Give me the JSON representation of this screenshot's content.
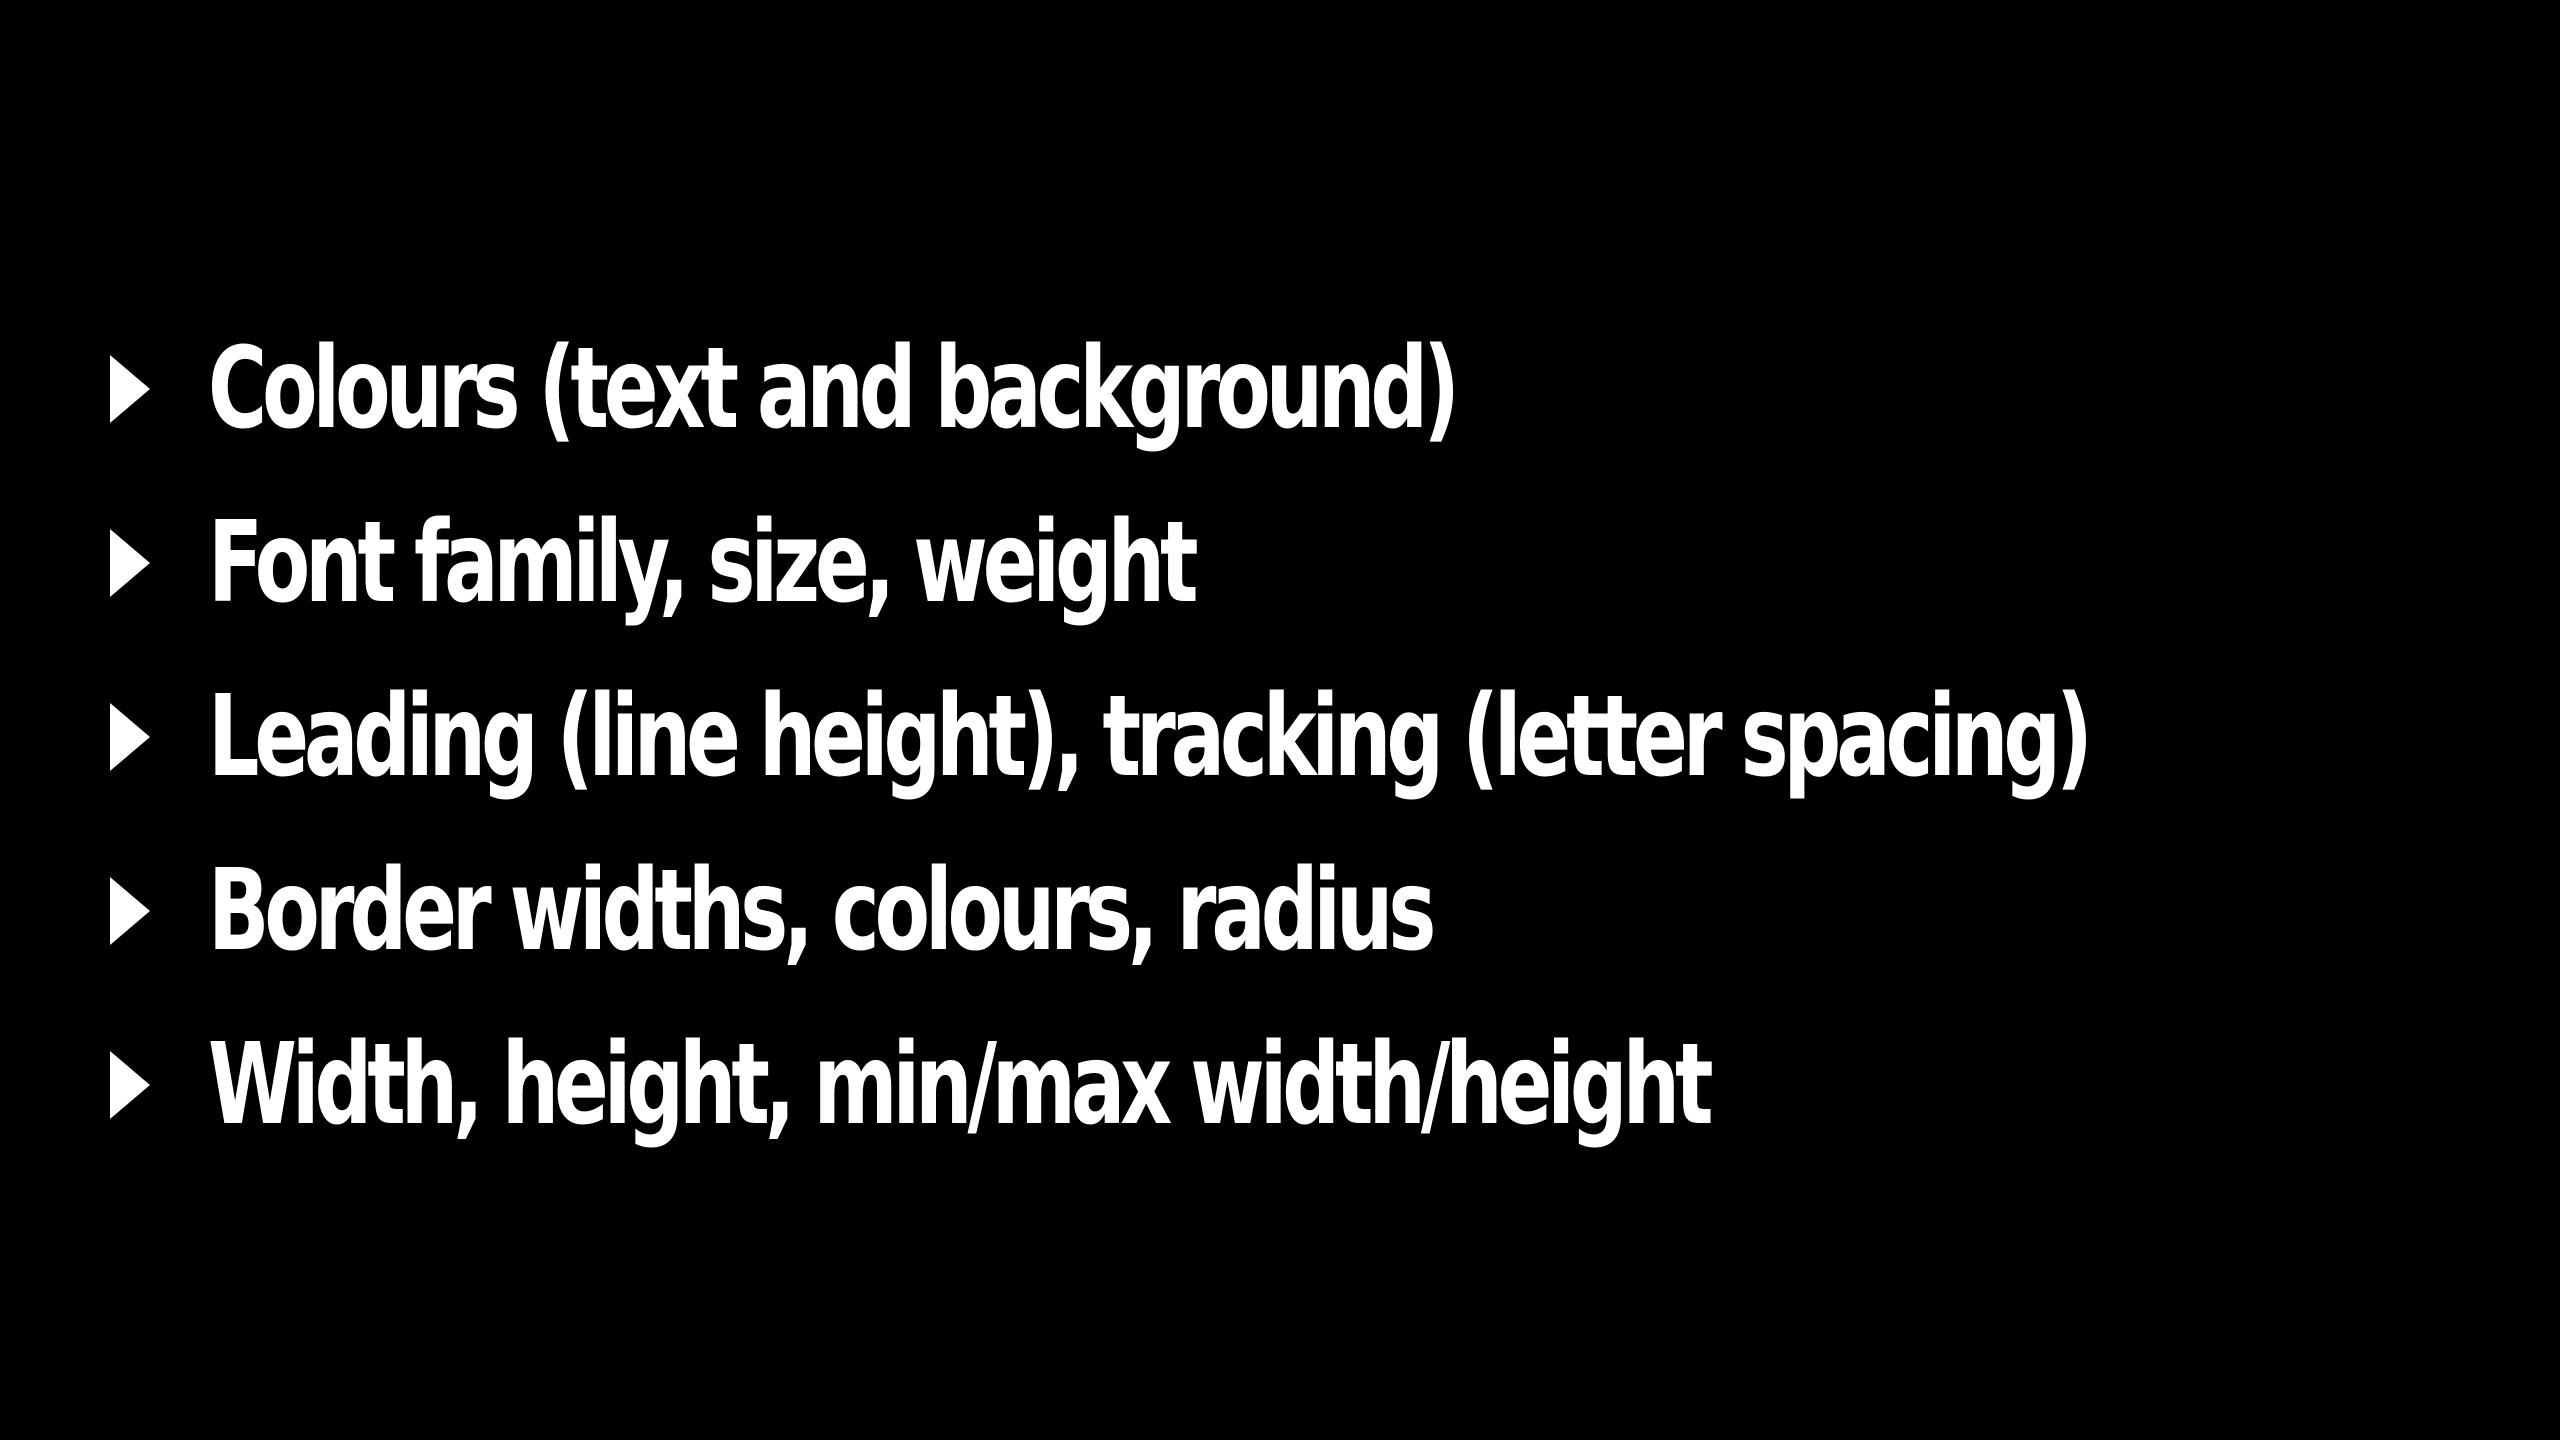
{
  "slide": {
    "background_color": "#000000",
    "text_color": "#ffffff",
    "bullet_icon": "triangle-right-icon",
    "items": [
      {
        "text": "Colours (text and background)"
      },
      {
        "text": "Font family, size, weight"
      },
      {
        "text": "Leading (line height), tracking (letter spacing)"
      },
      {
        "text": "Border widths, colours, radius"
      },
      {
        "text": "Width, height, min/max width/height"
      }
    ]
  }
}
